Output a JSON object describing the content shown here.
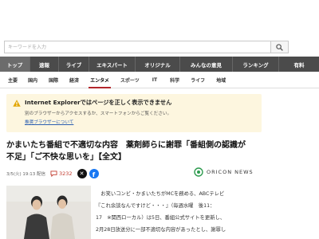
{
  "search": {
    "placeholder": "キーワードを入力"
  },
  "nav": {
    "items": [
      {
        "label": "トップ",
        "active": true
      },
      {
        "label": "速報"
      },
      {
        "label": "ライブ"
      },
      {
        "label": "エキスパート"
      },
      {
        "label": "オリジナル"
      },
      {
        "label": "みんなの意見"
      },
      {
        "label": "ランキング"
      },
      {
        "label": "有料"
      }
    ]
  },
  "subnav": {
    "items": [
      {
        "label": "主要"
      },
      {
        "label": "国内"
      },
      {
        "label": "国際"
      },
      {
        "label": "経済"
      },
      {
        "label": "エンタメ",
        "active": true
      },
      {
        "label": "スポーツ"
      },
      {
        "label": "IT"
      },
      {
        "label": "科学"
      },
      {
        "label": "ライフ"
      },
      {
        "label": "地域"
      }
    ]
  },
  "ie_banner": {
    "title": "Internet Explorerではページを正しく表示できません",
    "desc": "別のブラウザーからアクセスするか、スマートフォンからご覧ください。",
    "link": "推奨ブラウザーについて"
  },
  "article": {
    "title_lines": [
      "かまいたち番組で不適切な内容　薬剤師らに謝罪「番組側の認識が",
      "不足」「ご不快な思いを」【全文】"
    ],
    "time": "3/5(火) 19:13 配信",
    "comments": "3232",
    "source": "ORICON NEWS",
    "body_lines": [
      "　お笑いコンビ・かまいたちがMCを務める、ABCテレビ",
      "『これ余談なんですけど・・・』（毎週水曜　後11：",
      "17　※関西ローカル）は5日、番組公式サイトを更新し、",
      "2月28日放送分に一部不適切な内容があったとし、謝罪し"
    ]
  },
  "colors": {
    "navbar": "#4b4b4b",
    "banner": "#fdf6df",
    "accent": "#c23b2f",
    "link": "#2a5db0"
  }
}
